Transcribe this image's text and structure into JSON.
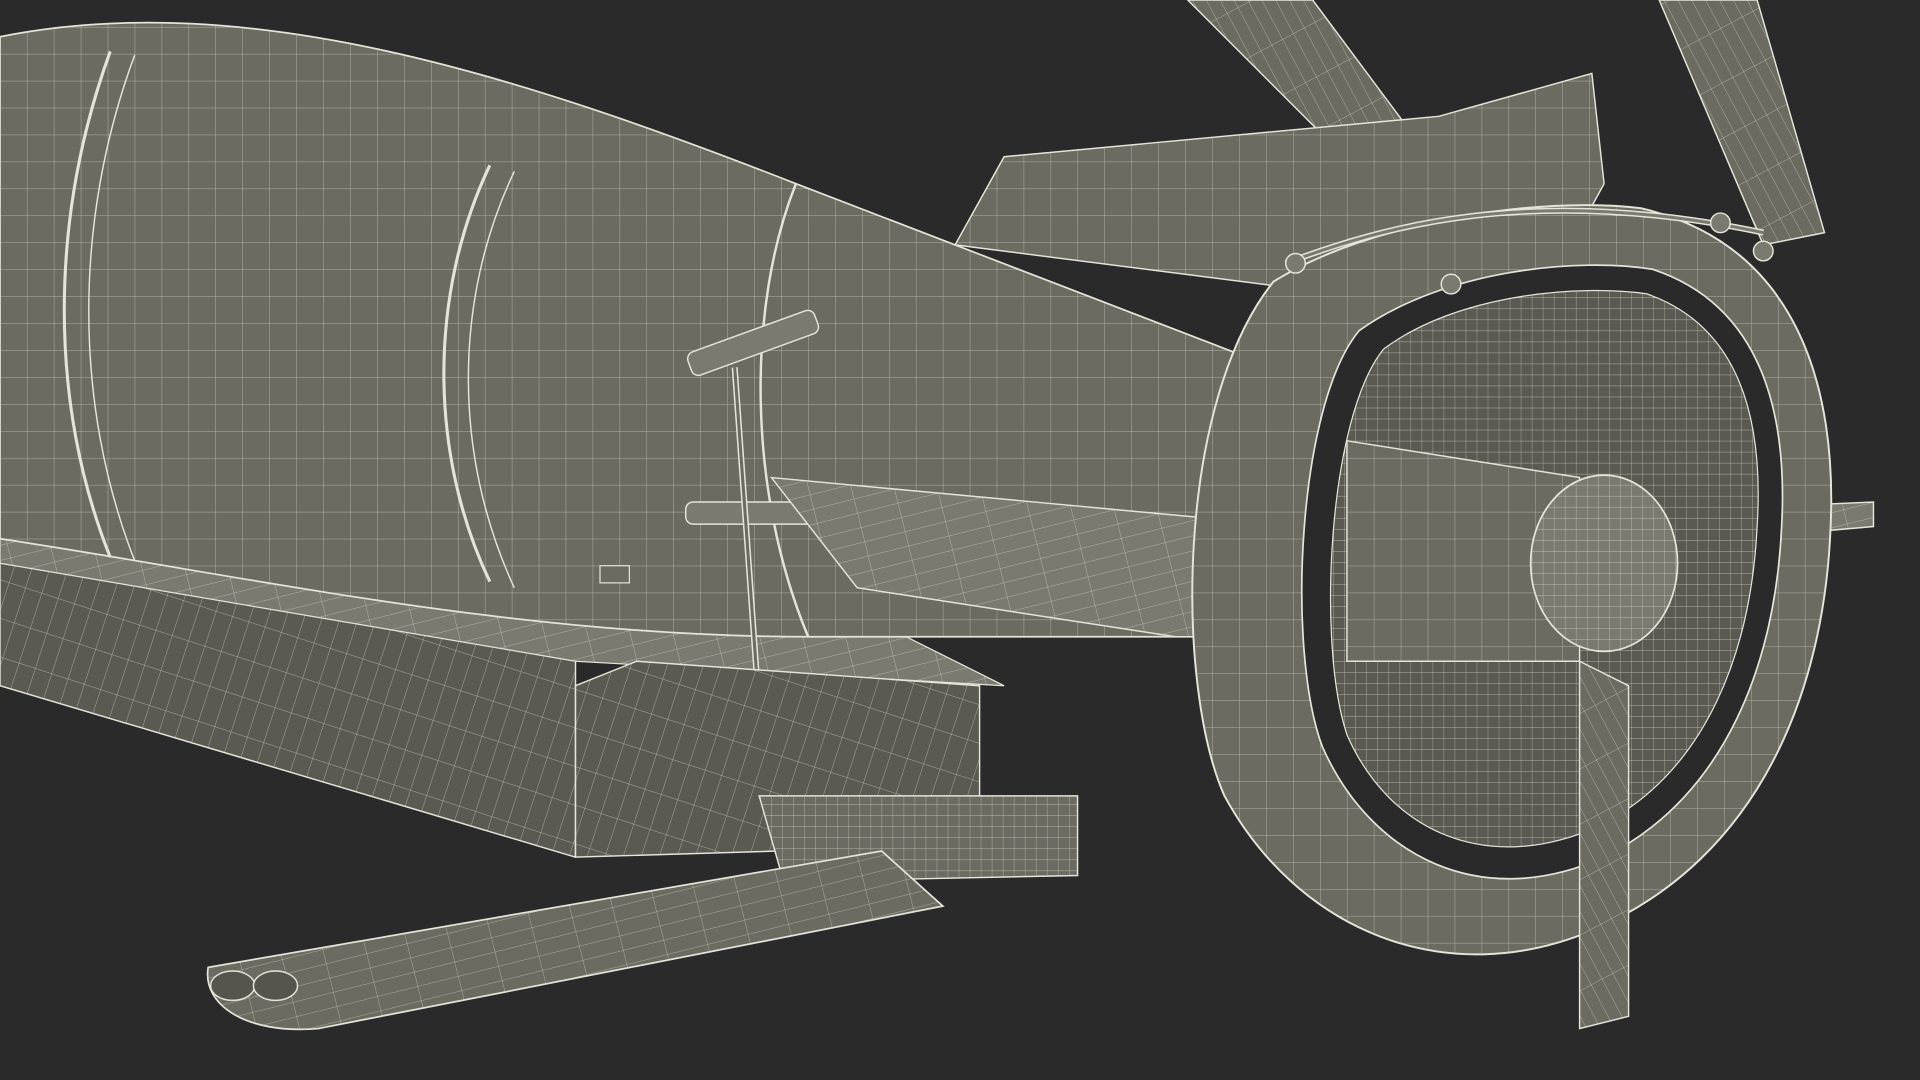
{
  "scene": {
    "background_color": "#2a2a2a",
    "surface_color": "#6b6b62",
    "surface_light_color": "#7a7a70",
    "surface_dark_color": "#55554e",
    "wire_color": "#e4e4d8",
    "subject": "wireframe-3d-model-bomb-tail-assembly"
  }
}
